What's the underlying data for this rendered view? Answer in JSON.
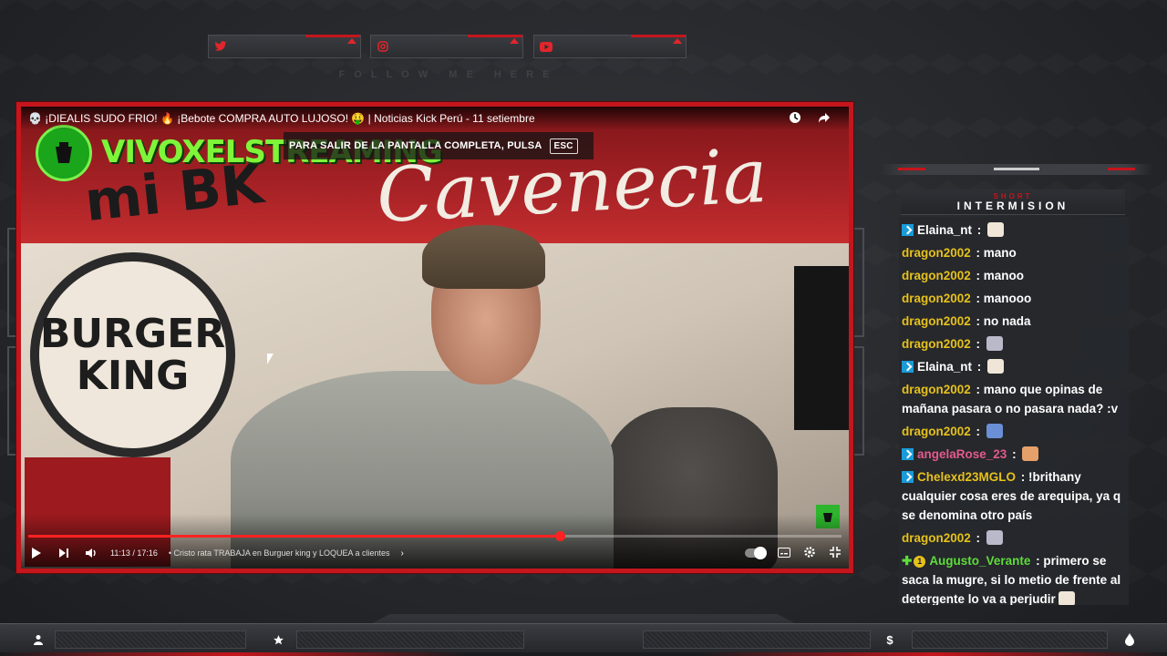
{
  "social": {
    "items": [
      {
        "icon": "twitter-icon"
      },
      {
        "icon": "instagram-icon"
      },
      {
        "icon": "youtube-icon"
      }
    ],
    "follow_text": "FOLLOW ME HERE"
  },
  "video": {
    "title": "💀 ¡DIEALIS SUDO FRIO! 🔥 ¡Bebote COMPRA AUTO LUJOSO! 🤑 | Noticias Kick Perú - 11 setiembre",
    "channel_name": "VIVOXELSTREAMING",
    "fullscreen_hint": "PARA SALIR DE LA PANTALLA COMPLETA, PULSA",
    "esc_key": "ESC",
    "scene_text": {
      "mibk": "mi BK",
      "cavenecia": "Cavenecia",
      "bk_line1": "BURGER",
      "bk_line2": "KING"
    },
    "time": "11:13 / 17:16",
    "chapter": "• Cristo rata TRABAJA en Burguer king y LOQUEA a clientes",
    "progress": 0.654,
    "accent_color": "#c4161c"
  },
  "chat": {
    "header_small": "SHORT",
    "header_big": "INTERMISION",
    "messages": [
      {
        "user": "Elaina_nt",
        "color": "#ffffff",
        "badge": "prime",
        "text": "",
        "emote": true
      },
      {
        "user": "dragon2002",
        "color": "#e6c11c",
        "badge": "",
        "text": "mano",
        "emote": false
      },
      {
        "user": "dragon2002",
        "color": "#e6c11c",
        "badge": "",
        "text": "manoo",
        "emote": false
      },
      {
        "user": "dragon2002",
        "color": "#e6c11c",
        "badge": "",
        "text": "manooo",
        "emote": false
      },
      {
        "user": "dragon2002",
        "color": "#e6c11c",
        "badge": "",
        "text": "no nada",
        "emote": false
      },
      {
        "user": "dragon2002",
        "color": "#e6c11c",
        "badge": "",
        "text": "",
        "emote": true
      },
      {
        "user": "Elaina_nt",
        "color": "#ffffff",
        "badge": "prime",
        "text": "",
        "emote": true
      },
      {
        "user": "dragon2002",
        "color": "#e6c11c",
        "badge": "",
        "text": "mano que opinas de mañana pasara o no pasara nada? :v",
        "emote": false
      },
      {
        "user": "dragon2002",
        "color": "#e6c11c",
        "badge": "",
        "text": "",
        "emote": true
      },
      {
        "user": "angelaRose_23",
        "color": "#e35a8a",
        "badge": "prime",
        "text": "",
        "emote": true
      },
      {
        "user": "Chelexd23MGLO",
        "color": "#e6c11c",
        "badge": "prime",
        "text": "!brithany cualquier cosa eres de arequipa, ya q se denomina otro país",
        "emote": false
      },
      {
        "user": "dragon2002",
        "color": "#e6c11c",
        "badge": "",
        "text": "",
        "emote": true
      },
      {
        "user": "Augusto_Verante",
        "color": "#5fdc3a",
        "badge": "green",
        "text": "primero se saca la mugre, si lo metio de frente al detergente lo va a perjudir",
        "emote": true
      }
    ]
  },
  "bottom_bar": {
    "icons": [
      "user-icon",
      "star-icon",
      "dollar-icon",
      "flame-icon"
    ],
    "dollar": "$"
  }
}
